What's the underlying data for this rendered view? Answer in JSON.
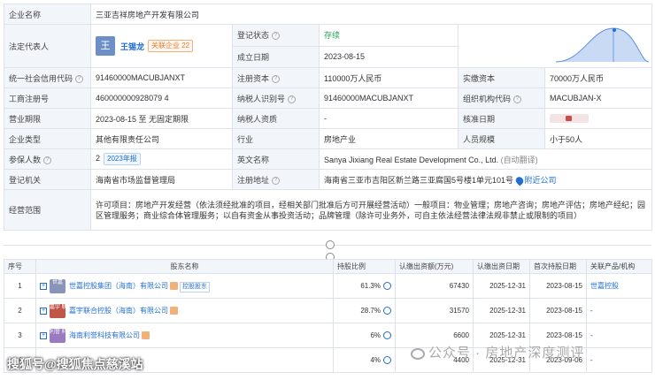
{
  "company": {
    "name_label": "企业名称",
    "name": "三亚吉祥房地产开发有限公司",
    "rep_label": "法定代表人",
    "rep_avatar": "王",
    "rep_name": "王锡龙",
    "rep_assoc": "关联企业 22",
    "status_label": "登记状态",
    "status": "存续",
    "founded_label": "成立日期",
    "founded": "2023-08-15",
    "credit_label": "统一社会信用代码",
    "credit": "91460000MACUBJANXT",
    "reg_capital_label": "注册资本",
    "reg_capital": "110000万人民币",
    "paid_capital_label": "实缴资本",
    "paid_capital": "70000万人民币",
    "biz_reg_label": "工商注册号",
    "biz_reg": "460000000928079 4",
    "taxpayer_id_label": "纳税人识别号",
    "taxpayer_id": "91460000MACUBJANXT",
    "org_code_label": "组织机构代码",
    "org_code": "MACUBJAN-X",
    "term_label": "营业期限",
    "term": "2023-08-15 至 无固定期限",
    "taxpayer_qual_label": "纳税人资质",
    "taxpayer_qual": "-",
    "approve_label": "核准日期",
    "type_label": "企业类型",
    "type": "其他有限责任公司",
    "industry_label": "行业",
    "industry": "房地产业",
    "staff_label": "人员规模",
    "staff": "小于50人",
    "insured_label": "参保人数",
    "insured": "2",
    "insured_badge": "2023年报",
    "en_name_label": "英文名称",
    "en_name": "Sanya Jixiang Real Estate Development Co., Ltd.",
    "en_auto": "(自动翻译)",
    "authority_label": "登记机关",
    "authority": "海南省市场监督管理局",
    "address_label": "注册地址",
    "address": "海南省三亚市吉阳区新兰路三亚腐国5号楼1单元101号",
    "nearby": "附近公司",
    "scope_label": "经营范围",
    "scope": "许可项目：房地产开发经营（依法须经批准的项目，经相关部门批准后方可开展经营活动）一般项目：物业管理；房地产咨询；房地产评估；房地产经纪；园区管理服务；商业综合体管理服务；以自有资金从事投资活动；品牌管理（除许可业务外，可自主依法经营法律法规非禁止或限制的项目）"
  },
  "holders": {
    "headers": [
      "序号",
      "股东名称",
      "持股比例",
      "认缴出资额(万元)",
      "认缴出资日期",
      "首次持股日期",
      "关联产品/机构"
    ],
    "rows": [
      {
        "no": "1",
        "logo": "世嘉",
        "logo_color": "#8a94b8",
        "name": "世嘉控股集团（海南）有限公司",
        "tag": "控股股东",
        "pct": "61.3%",
        "amount": "67430",
        "date": "2025-12-31",
        "first": "2023-08-15",
        "assoc": "世嘉控股"
      },
      {
        "no": "2",
        "logo": "嘉宇 联合",
        "logo_color": "#c0564a",
        "name": "嘉宇联合控股（海南）有限公司",
        "tag": "",
        "pct": "28.7%",
        "amount": "31570",
        "date": "2025-12-31",
        "first": "2023-08-15",
        "assoc": "-"
      },
      {
        "no": "3",
        "logo": "利誉 科技",
        "logo_color": "#9a7bc2",
        "name": "海南利誉科技有限公司",
        "tag": "",
        "pct": "6%",
        "amount": "6600",
        "date": "2025-12-31",
        "first": "2023-08-15",
        "assoc": "-"
      },
      {
        "no": "4",
        "logo": "",
        "logo_color": "#8a94b8",
        "name": "",
        "tag": "",
        "pct": "4%",
        "amount": "4400",
        "date": "2025-12-31",
        "first": "2023-09-06",
        "assoc": "-"
      }
    ]
  },
  "watermarks": {
    "bottom_left": "搜狐号@搜狐焦点慈溪站",
    "bottom_right": "公众号 · 房地产深度测评"
  },
  "colors": {
    "accent": "#1f6ed4",
    "status_green": "#2aa15b",
    "label_bg": "#f2f6fb"
  }
}
